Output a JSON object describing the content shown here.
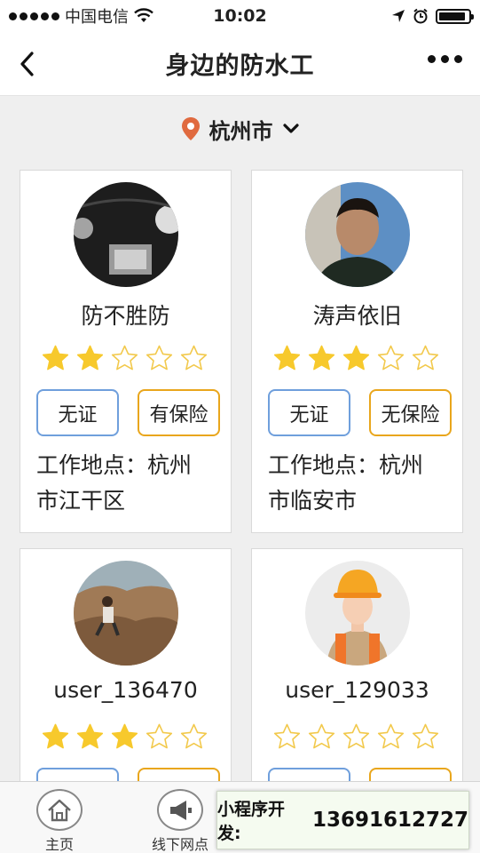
{
  "status_bar": {
    "carrier": "中国电信",
    "time": "10:02"
  },
  "header": {
    "title": "身边的防水工"
  },
  "location": {
    "city": "杭州市"
  },
  "colors": {
    "star_filled": "#f7c92c",
    "star_empty_outline": "#f2c94c",
    "cert_border": "#6f9fdc",
    "insurance_border": "#e9a61c",
    "location_pin": "#e06a3f"
  },
  "workers": [
    {
      "name": "防不胜防",
      "rating": 2,
      "max_rating": 5,
      "certificate": "无证",
      "insurance": "有保险",
      "location_label": "工作地点：",
      "location": "杭州市江干区"
    },
    {
      "name": "涛声依旧",
      "rating": 3,
      "max_rating": 5,
      "certificate": "无证",
      "insurance": "无保险",
      "location_label": "工作地点：",
      "location": "杭州市临安市"
    },
    {
      "name": "user_136470",
      "rating": 3,
      "max_rating": 5
    },
    {
      "name": "user_129033",
      "rating": 0,
      "max_rating": 5
    }
  ],
  "tab_bar": {
    "items": [
      {
        "label": "主页",
        "icon": "home-icon"
      },
      {
        "label": "线下网点",
        "icon": "megaphone-icon"
      }
    ]
  },
  "promo": {
    "label": "小程序开发:",
    "phone": "13691612727"
  }
}
